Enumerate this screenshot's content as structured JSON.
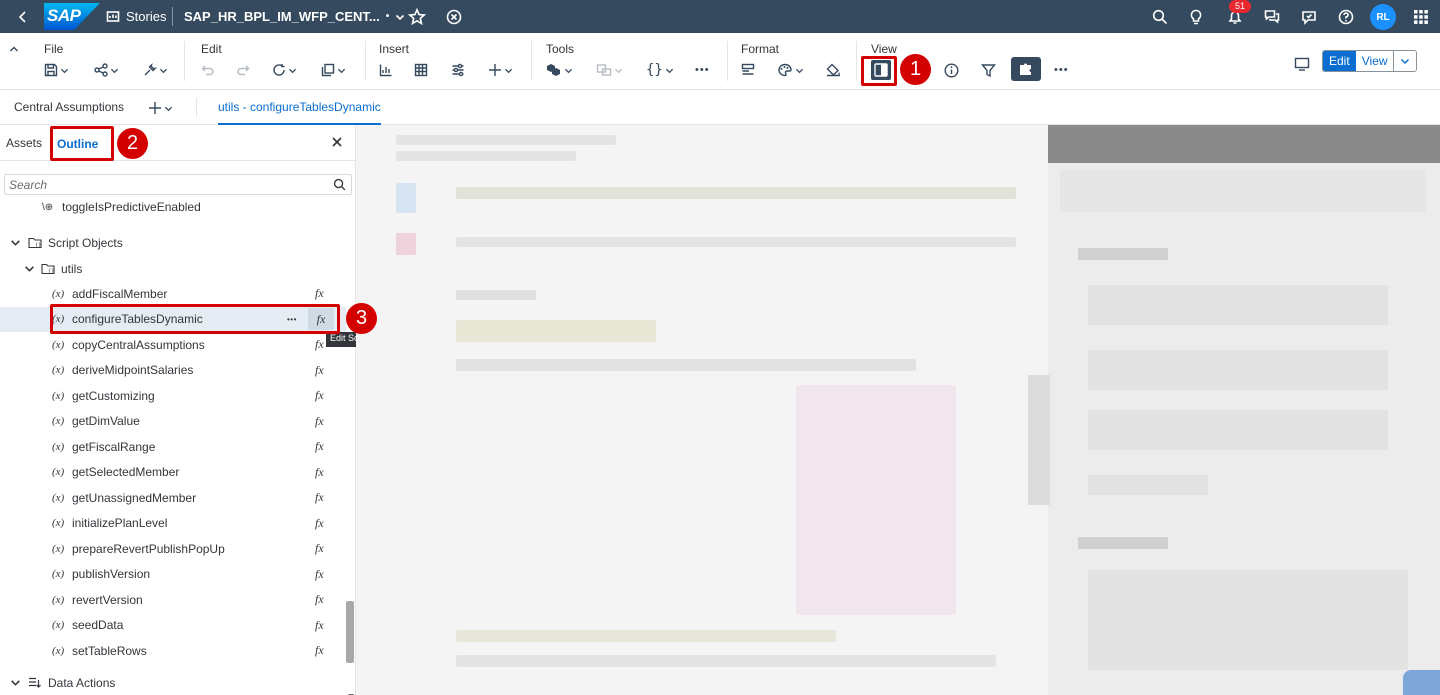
{
  "shell": {
    "logo": "SAP",
    "app_name": "Stories",
    "doc_title": "SAP_HR_BPL_IM_WFP_CENT...",
    "unsaved_marker": "•",
    "notification_count": "51",
    "avatar": "RL"
  },
  "toolbar": {
    "groups": {
      "file": "File",
      "edit": "Edit",
      "insert": "Insert",
      "tools": "Tools",
      "format": "Format",
      "view": "View"
    },
    "mode_edit": "Edit",
    "mode_view": "View"
  },
  "tabs": {
    "central": "Central Assumptions",
    "active": "utils - configureTablesDynamic"
  },
  "pane": {
    "tab_assets": "Assets",
    "tab_outline": "Outline",
    "search_placeholder": "Search",
    "partial_item": "toggleIsPredictiveEnabled",
    "script_objects": "Script Objects",
    "utils": "utils",
    "var_symbol": "(x)",
    "fx_symbol": "fx",
    "more_symbol": "•••",
    "items": [
      "addFiscalMember",
      "configureTablesDynamic",
      "copyCentralAssumptions",
      "deriveMidpointSalaries",
      "getCustomizing",
      "getDimValue",
      "getFiscalRange",
      "getSelectedMember",
      "getUnassignedMember",
      "initializePlanLevel",
      "prepareRevertPublishPopUp",
      "publishVersion",
      "revertVersion",
      "seedData",
      "setTableRows"
    ],
    "data_actions": "Data Actions",
    "tooltip": "Edit Script"
  },
  "callouts": [
    "1",
    "2",
    "3"
  ],
  "colors": {
    "shell": "#354a5f",
    "accent": "#0a6ed1",
    "callout": "#d40000"
  }
}
